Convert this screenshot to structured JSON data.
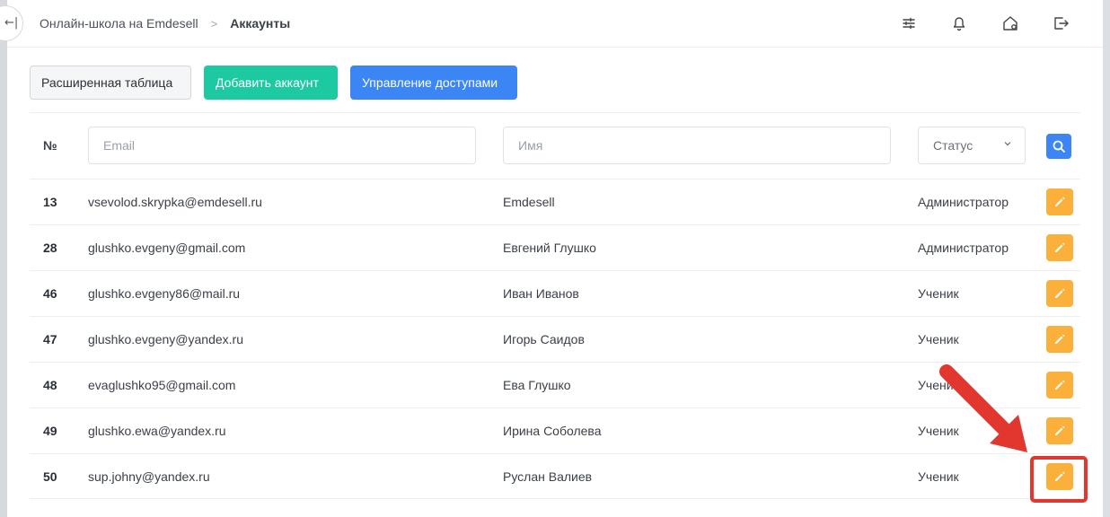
{
  "breadcrumb": {
    "school": "Онлайн-школа на Emdesell",
    "current": "Аккаунты",
    "separator": ">"
  },
  "top_icons": [
    "sliders-icon",
    "bell-icon",
    "home-settings-icon",
    "logout-icon"
  ],
  "toolbar": {
    "extended_table": "Расширенная таблица",
    "add_account": "Добавить аккаунт",
    "access_management": "Управление доступами"
  },
  "filters": {
    "number_header": "№",
    "email_placeholder": "Email",
    "name_placeholder": "Имя",
    "status_label": "Статус"
  },
  "rows": [
    {
      "id": "13",
      "email": "vsevolod.skrypka@emdesell.ru",
      "name": "Emdesell",
      "status": "Администратор"
    },
    {
      "id": "28",
      "email": "glushko.evgeny@gmail.com",
      "name": "Евгений Глушко",
      "status": "Администратор"
    },
    {
      "id": "46",
      "email": "glushko.evgeny86@mail.ru",
      "name": "Иван Иванов",
      "status": "Ученик"
    },
    {
      "id": "47",
      "email": "glushko.evgeny@yandex.ru",
      "name": "Игорь Саидов",
      "status": "Ученик"
    },
    {
      "id": "48",
      "email": "evaglushko95@gmail.com",
      "name": "Ева Глушко",
      "status": "Ученик"
    },
    {
      "id": "49",
      "email": "glushko.ewa@yandex.ru",
      "name": "Ирина Соболева",
      "status": "Ученик"
    },
    {
      "id": "50",
      "email": "sup.johny@yandex.ru",
      "name": "Руслан Валиев",
      "status": "Ученик"
    }
  ],
  "colors": {
    "green": "#1cc9a0",
    "blue": "#3b86f4",
    "edit": "#fbb03b",
    "annotation": "#e1372f"
  }
}
